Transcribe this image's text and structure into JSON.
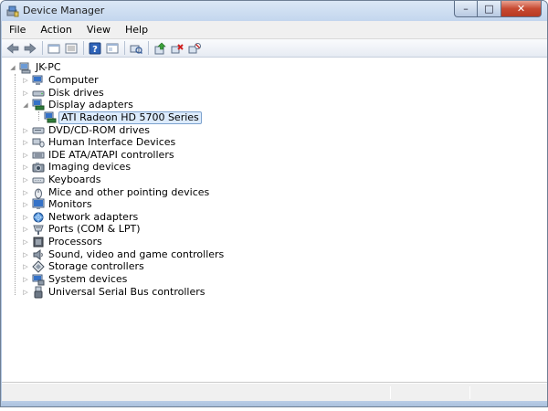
{
  "window": {
    "title": "Device Manager"
  },
  "caption_buttons": {
    "minimize": "–",
    "maximize": "□",
    "close": "✕"
  },
  "menu": [
    "File",
    "Action",
    "View",
    "Help"
  ],
  "toolbar": [
    "back-icon",
    "forward-icon",
    "up-folder-icon",
    "properties-icon",
    "help-icon",
    "view-icon",
    "scan-hardware-icon",
    "update-driver-icon",
    "uninstall-icon",
    "disable-icon"
  ],
  "tree": {
    "root": "JK-PC",
    "categories": [
      {
        "label": "Computer",
        "icon": "computer-icon"
      },
      {
        "label": "Disk drives",
        "icon": "disk-drive-icon"
      },
      {
        "label": "Display adapters",
        "icon": "display-adapter-icon",
        "expanded": true
      },
      {
        "label": "DVD/CD-ROM drives",
        "icon": "dvd-drive-icon"
      },
      {
        "label": "Human Interface Devices",
        "icon": "hid-icon"
      },
      {
        "label": "IDE ATA/ATAPI controllers",
        "icon": "ide-controller-icon"
      },
      {
        "label": "Imaging devices",
        "icon": "camera-icon"
      },
      {
        "label": "Keyboards",
        "icon": "keyboard-icon"
      },
      {
        "label": "Mice and other pointing devices",
        "icon": "mouse-icon"
      },
      {
        "label": "Monitors",
        "icon": "monitor-icon"
      },
      {
        "label": "Network adapters",
        "icon": "network-icon"
      },
      {
        "label": "Ports (COM & LPT)",
        "icon": "port-icon"
      },
      {
        "label": "Processors",
        "icon": "processor-icon"
      },
      {
        "label": "Sound, video and game controllers",
        "icon": "speaker-icon"
      },
      {
        "label": "Storage controllers",
        "icon": "storage-controller-icon"
      },
      {
        "label": "System devices",
        "icon": "system-device-icon"
      },
      {
        "label": "Universal Serial Bus controllers",
        "icon": "usb-icon"
      }
    ],
    "child": {
      "label": "ATI Radeon HD 5700 Series",
      "icon": "display-adapter-icon"
    }
  },
  "colors": {
    "selection_bg": "#dcebfc",
    "selection_border": "#7da2ce",
    "frame": "#b9cde6"
  }
}
